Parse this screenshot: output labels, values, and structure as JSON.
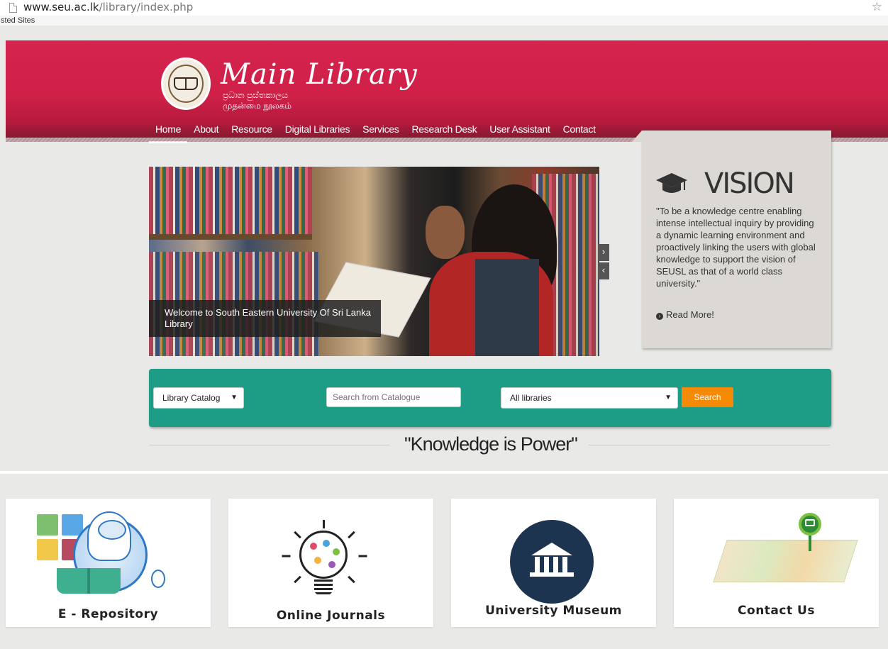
{
  "browser": {
    "url_host": "www.seu.ac.lk",
    "url_path": "/library/index.php",
    "bookmarks_label": "sted Sites"
  },
  "header": {
    "title": "Main Library",
    "subtitle_sinhala": "ප්‍රධාන පුස්තකාලය",
    "subtitle_tamil": "முதன்மை நூலகம்"
  },
  "nav": {
    "items": [
      "Home",
      "About",
      "Resource",
      "Digital Libraries",
      "Services",
      "Research Desk",
      "User Assistant",
      "Contact"
    ],
    "active": "Home"
  },
  "vision": {
    "title": "VISION",
    "text": "\"To be a knowledge centre enabling intense intellectual inquiry by providing a dynamic learning environment and proactively linking the users with global knowledge to support the vision of SEUSL as that of a world class university.\"",
    "read_more": "Read More!",
    "icon": "graduation-cap-icon"
  },
  "slider": {
    "caption": "Welcome to South Eastern University Of Sri Lanka Library",
    "next_icon": "›",
    "prev_icon": "‹"
  },
  "search": {
    "catalog_select": "Library Catalog",
    "placeholder": "Search from Catalogue",
    "libraries_select": "All libraries",
    "button": "Search"
  },
  "quote": "\"Knowledge is Power\"",
  "cards": [
    {
      "label": "E - Repository",
      "icon": "e-repository-icon"
    },
    {
      "label": "Online Journals",
      "icon": "lightbulb-brain-icon"
    },
    {
      "label": "University Museum",
      "icon": "museum-icon"
    },
    {
      "label": "Contact Us",
      "icon": "map-pin-icon"
    }
  ],
  "colors": {
    "header": "#d5244f",
    "search_bar": "#1d9d86",
    "search_button": "#f58a07",
    "vision_bg": "#dcd9d4"
  }
}
